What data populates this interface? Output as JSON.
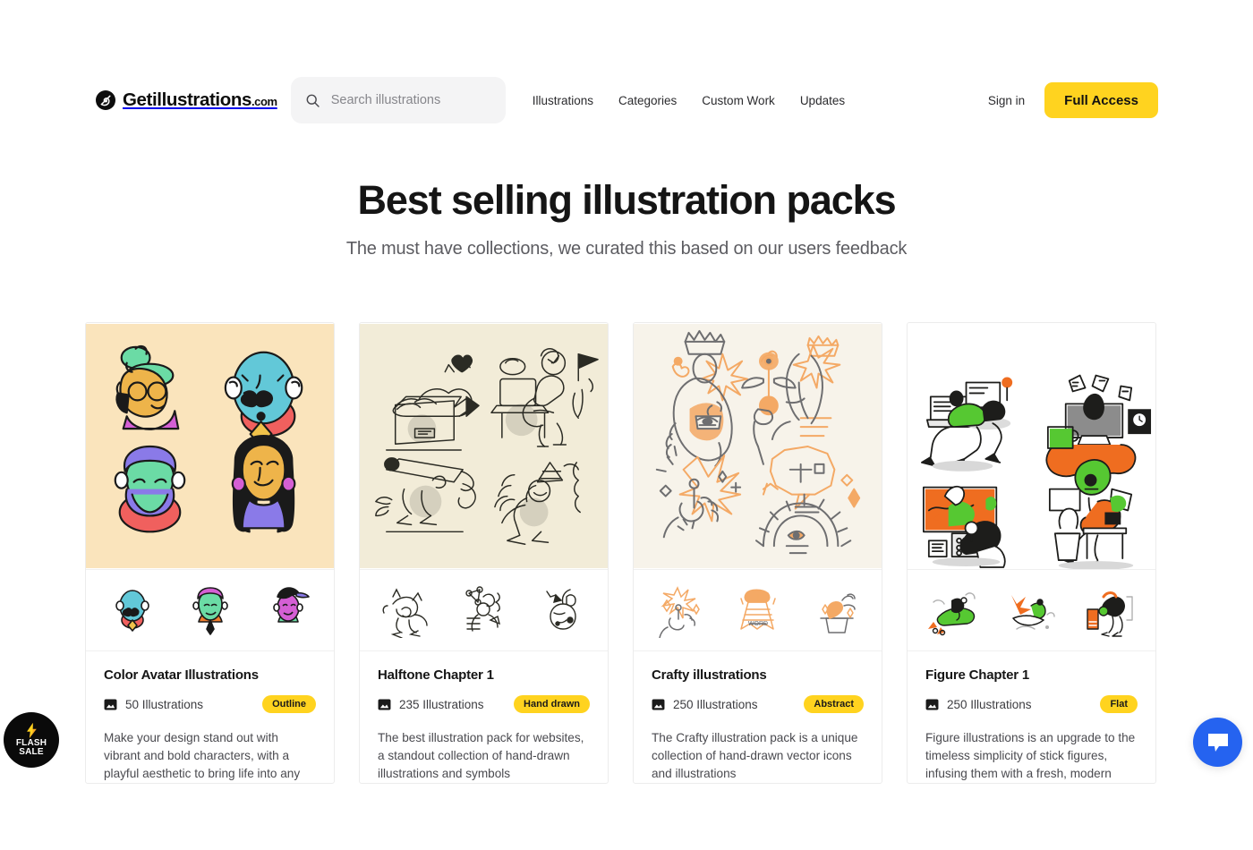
{
  "header": {
    "logo_text": "Getillustrations",
    "logo_suffix": ".com",
    "logo_icon": "hand-swirl-logo-icon",
    "search": {
      "placeholder": "Search illustrations",
      "value": "",
      "icon": "search-icon"
    },
    "nav": [
      {
        "label": "Illustrations"
      },
      {
        "label": "Categories"
      },
      {
        "label": "Custom Work"
      },
      {
        "label": "Updates"
      }
    ],
    "sign_in_label": "Sign in",
    "full_access_label": "Full Access",
    "accent_color": "#ffd31f"
  },
  "hero": {
    "title": "Best selling illustration packs",
    "subtitle": "The must have collections, we curated this based on our users feedback"
  },
  "cards": [
    {
      "title": "Color Avatar Illustrations",
      "count_label": "50 Illustrations",
      "count_icon": "image-icon",
      "tag": "Outline",
      "description": "Make your design stand out with vibrant and bold characters, with a playful aesthetic to bring life into any",
      "hero_bg": "#fae4bc",
      "thumbs_bg": "#ffffff",
      "style": "color-avatars"
    },
    {
      "title": "Halftone Chapter 1",
      "count_label": "235 Illustrations",
      "count_icon": "image-icon",
      "tag": "Hand drawn",
      "description": "The best illustration pack for websites, a standout collection of hand-drawn illustrations and symbols",
      "hero_bg": "#f2ecd8",
      "thumbs_bg": "#ffffff",
      "style": "halftone"
    },
    {
      "title": "Crafty illustrations",
      "count_label": "250 Illustrations",
      "count_icon": "image-icon",
      "tag": "Abstract",
      "description": "The Crafty illustration pack is a unique collection of hand-drawn vector icons and illustrations",
      "hero_bg": "#f7f3ea",
      "thumbs_bg": "#ffffff",
      "style": "crafty"
    },
    {
      "title": "Figure Chapter 1",
      "count_label": "250 Illustrations",
      "count_icon": "image-icon",
      "tag": "Flat",
      "description": "Figure illustrations is an upgrade to the timeless simplicity of stick figures, infusing them with a fresh, modern",
      "hero_bg": "#ffffff",
      "thumbs_bg": "#ffffff",
      "style": "figure"
    }
  ],
  "floating": {
    "flash_sale_line1": "FLASH",
    "flash_sale_line2": "SALE",
    "flash_icon": "lightning-bolt-icon",
    "flash_bg": "#0a0a0a",
    "chat_icon": "chat-bubble-icon",
    "chat_bg": "#2563f0"
  }
}
